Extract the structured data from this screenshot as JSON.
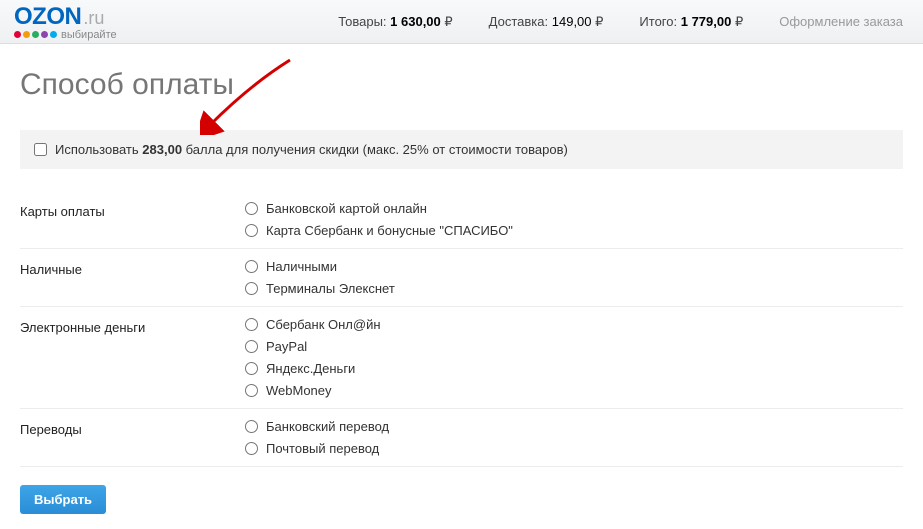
{
  "logo": {
    "brand": "OZON",
    "suffix": ".ru",
    "tagline": "выбирайте"
  },
  "summary": {
    "goods_label": "Товары:",
    "goods_value": "1 630,00",
    "delivery_label": "Доставка:",
    "delivery_value": "149,00",
    "total_label": "Итого:",
    "total_value": "1 779,00",
    "checkout": "Оформление заказа"
  },
  "page_title": "Способ оплаты",
  "bonus": {
    "prefix": "Использовать ",
    "points": "283,00",
    "suffix": " балла для получения скидки (макс. 25% от стоимости товаров)"
  },
  "groups": [
    {
      "label": "Карты оплаты",
      "options": [
        "Банковской картой онлайн",
        "Карта Сбербанк и бонусные \"СПАСИБО\""
      ]
    },
    {
      "label": "Наличные",
      "options": [
        "Наличными",
        "Терминалы Элекснет"
      ]
    },
    {
      "label": "Электронные деньги",
      "options": [
        "Сбербанк Онл@йн",
        "PayPal",
        "Яндекс.Деньги",
        "WebMoney"
      ]
    },
    {
      "label": "Переводы",
      "options": [
        "Банковский перевод",
        "Почтовый перевод"
      ]
    }
  ],
  "select_button": "Выбрать"
}
